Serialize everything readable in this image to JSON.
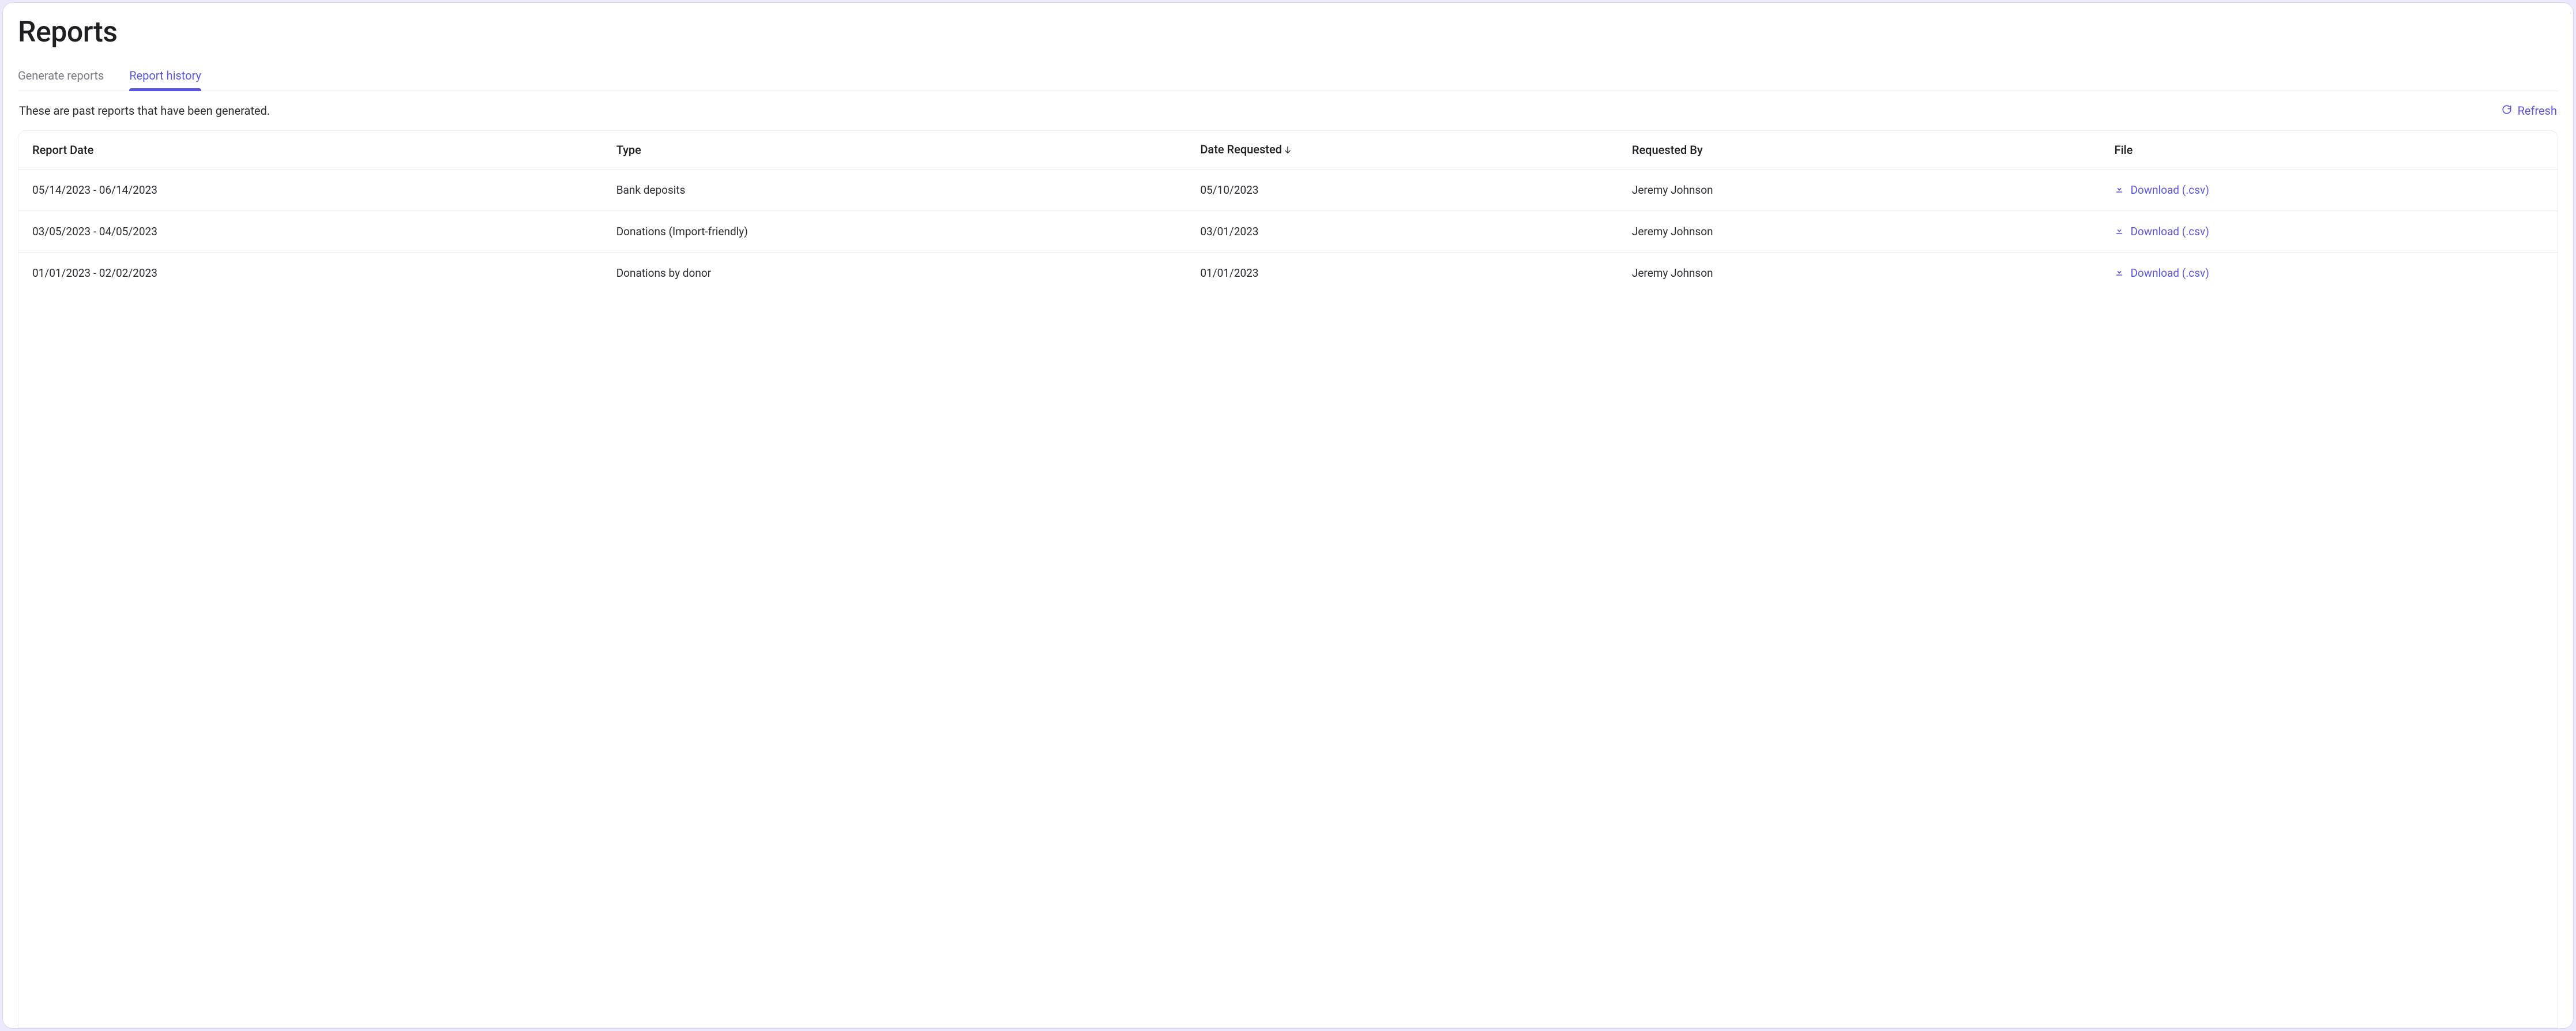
{
  "page": {
    "title": "Reports"
  },
  "tabs": [
    {
      "label": "Generate reports",
      "active": false
    },
    {
      "label": "Report history",
      "active": true
    }
  ],
  "subheader": {
    "text": "These are past reports that have been generated.",
    "refresh_label": "Refresh"
  },
  "table": {
    "columns": {
      "report_date": "Report Date",
      "type": "Type",
      "date_requested": "Date Requested",
      "requested_by": "Requested By",
      "file": "File"
    },
    "sort": {
      "column": "date_requested",
      "direction": "desc"
    },
    "download_label": "Download (.csv)",
    "rows": [
      {
        "report_date": "05/14/2023 - 06/14/2023",
        "type": "Bank deposits",
        "date_requested": "05/10/2023",
        "requested_by": "Jeremy Johnson"
      },
      {
        "report_date": "03/05/2023 - 04/05/2023",
        "type": "Donations (Import-friendly)",
        "date_requested": "03/01/2023",
        "requested_by": "Jeremy Johnson"
      },
      {
        "report_date": "01/01/2023 - 02/02/2023",
        "type": "Donations by donor",
        "date_requested": "01/01/2023",
        "requested_by": "Jeremy Johnson"
      }
    ]
  }
}
